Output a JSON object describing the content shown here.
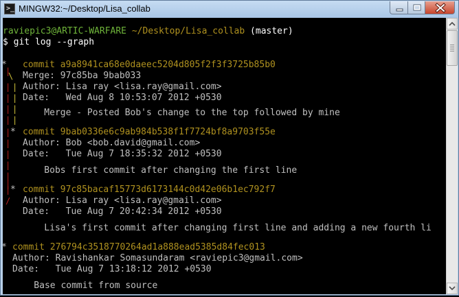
{
  "window": {
    "title": "MINGW32:~/Desktop/Lisa_collab",
    "app_icon": "terminal-icon",
    "controls": [
      "minimize-icon",
      "maximize-icon",
      "close-icon"
    ]
  },
  "terminal": {
    "prompt": {
      "user_host": "raviepic3@ARTIC-WARFARE",
      "path": "~/Desktop/Lisa_collab",
      "branch": "(master)"
    },
    "command": "$ git log --graph",
    "lines": {
      "c1_commit": "commit a9a8941ca68e0daeec5204d805f2f3f3725b85b0",
      "c1_merge": "Merge: 97c85ba 9bab033",
      "c1_author": "Author: Lisa ray <lisa.ray@gmail.com>",
      "c1_date": "Date:   Wed Aug 8 10:53:07 2012 +0530",
      "c1_message": "    Merge - Posted Bob's change to the top followed by mine",
      "c2_commit": "commit 9bab0336e6c9ab984b538f1f7724bf8a9703f55e",
      "c2_author": "Author: Bob <bob.david@gmail.com>",
      "c2_date": "Date:   Tue Aug 7 18:35:32 2012 +0530",
      "c2_message": "    Bobs first commit after changing the first line",
      "c3_commit": "commit 97c85bacaf15773d6173144c0d42e06b1ec792f7",
      "c3_author": "Author: Lisa ray <lisa.ray@gmail.com>",
      "c3_date": "Date:   Tue Aug 7 20:42:34 2012 +0530",
      "c3_message": "    Lisa's first commit after changing first line and adding a new fourth li",
      "c4_commit": "commit 276794c3518770264ad1a888ead5385d84fec013",
      "c4_author": "Author: Ravishankar Somasundaram <raviepic3@gmail.com>",
      "c4_date": "Date:   Tue Aug 7 13:18:12 2012 +0530",
      "c4_message": "    Base commit from source"
    },
    "graph": {
      "star": "*",
      "backslash": "\\",
      "slash": "/",
      "pipe": "|"
    }
  },
  "colors": {
    "terminal_bg": "#000000",
    "text": "#c0c0c0",
    "prompt_user": "#6fb43a",
    "prompt_path": "#b0921f",
    "commit_hash": "#b0921f",
    "graph_red": "#b8201e",
    "graph_yellow": "#cfc13a"
  }
}
